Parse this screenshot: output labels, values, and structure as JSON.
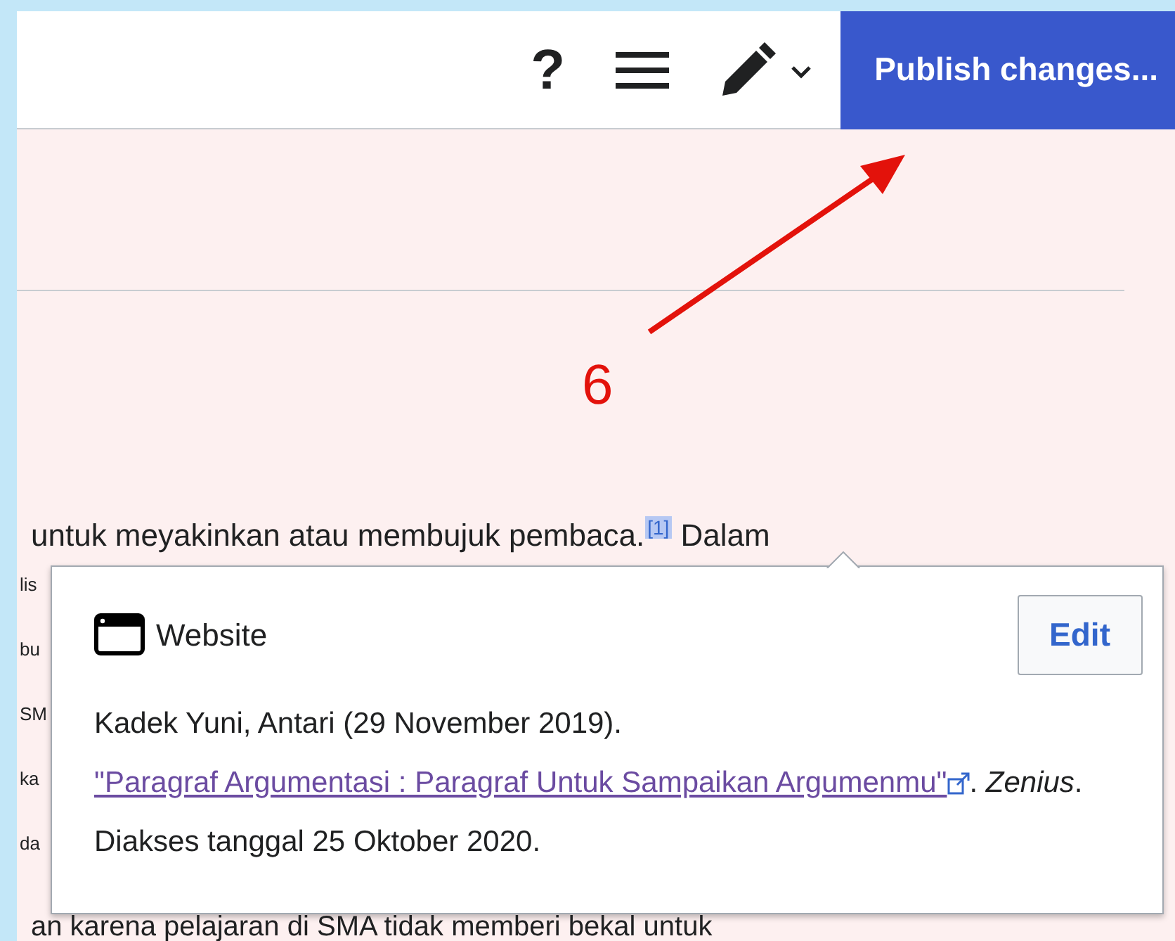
{
  "toolbar": {
    "help": "?",
    "publish_button": "Publish changes..."
  },
  "annotation": {
    "label": "6"
  },
  "paragraph": {
    "text": "untuk meyakinkan atau membujuk pembaca.",
    "ref": "[1]",
    "after": "Dalam"
  },
  "side_fragments": [
    "lis",
    "bu",
    "SM",
    "ka",
    "da"
  ],
  "popup": {
    "type": "Website",
    "edit_button": "Edit",
    "citation": "Kadek Yuni, Antari (29 November 2019). ",
    "link": "\"Paragraf Argumentasi : Paragraf Untuk Sampaikan Argumenmu\"",
    "after_link": ".",
    "source": "Zenius",
    "accessed": ". Diakses tanggal 25 Oktober 2020."
  },
  "bottom_line": "an karena pelajaran di SMA tidak memberi bekal untuk"
}
